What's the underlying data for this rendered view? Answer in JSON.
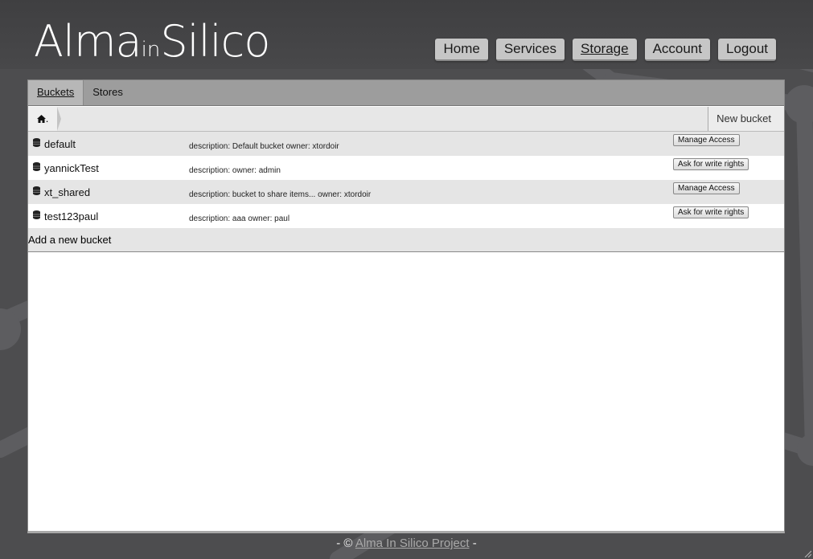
{
  "logo": {
    "part1": "Alma",
    "part2": "in",
    "part3": "Silico"
  },
  "nav": {
    "items": [
      {
        "label": "Home"
      },
      {
        "label": "Services"
      },
      {
        "label": "Storage",
        "active": true
      },
      {
        "label": "Account"
      },
      {
        "label": "Logout"
      }
    ]
  },
  "tabs": [
    {
      "label": "Buckets",
      "active": true
    },
    {
      "label": "Stores"
    }
  ],
  "toolbar": {
    "home_icon": "home-icon",
    "home_suffix": ".",
    "new_bucket_label": "New bucket"
  },
  "buckets": [
    {
      "name": "default",
      "description": "description: Default bucket owner: xtordoir",
      "action": "Manage Access"
    },
    {
      "name": "yannickTest",
      "description": "description: owner: admin",
      "action": "Ask for write rights"
    },
    {
      "name": "xt_shared",
      "description": "description: bucket to share items... owner: xtordoir",
      "action": "Manage Access"
    },
    {
      "name": "test123paul",
      "description": "description: aaa owner: paul",
      "action": "Ask for write rights"
    }
  ],
  "add_bucket_label": "Add a new bucket",
  "footer": {
    "prefix": "- ©",
    "link_text": "Alma In Silico Project",
    "suffix": "-"
  },
  "colors": {
    "background": "#4d4d4f",
    "tab_bar": "#9d9d9d",
    "row_alt": "#e5e5e5",
    "nav_button": "#c6c6c6"
  }
}
